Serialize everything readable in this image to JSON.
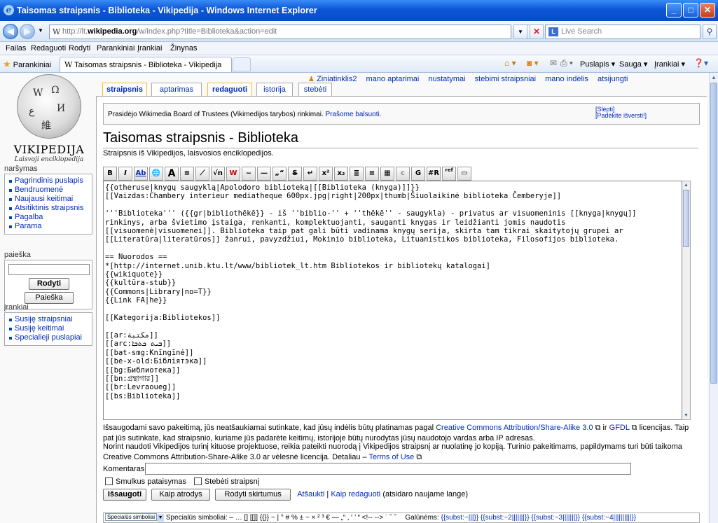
{
  "browser": {
    "window_title": "Taisomas straipsnis - Biblioteka - Vikipedija - Windows Internet Explorer",
    "address_prefix": "http://lt.",
    "address_domain": "wikipedia.org",
    "address_rest": "/w/index.php?title=Biblioteka&action=edit",
    "search_placeholder": "Live Search",
    "menu": [
      "Failas",
      "Redaguoti",
      "Rodyti",
      "Parankiniai",
      "Įrankiai",
      "Žinynas"
    ],
    "favorites_label": "Parankiniai",
    "tab_title": "Taisomas straipsnis - Biblioteka - Vikipedija",
    "page_menu": "Puslapis",
    "safety_menu": "Sauga",
    "tools_menu": "Įrankiai"
  },
  "logo": {
    "wordmark": "VIKIPEDIJA",
    "tagline": "Laisvoji enciklopedija"
  },
  "sidebar": {
    "nav_title": "naršymas",
    "nav_items": [
      "Pagrindinis puslapis",
      "Bendruomenė",
      "Naujausi keitimai",
      "Atsitiktinis straipsnis",
      "Pagalba",
      "Parama"
    ],
    "search_title": "paieška",
    "search_go": "Rodyti",
    "search_btn": "Paieška",
    "tools_title": "įrankiai",
    "tools_items": [
      "Susiję straipsniai",
      "Susiję keitimai",
      "Specialieji puslapiai"
    ]
  },
  "personal": {
    "user": "Ziniatinklis2",
    "links": [
      "mano aptarimai",
      "nustatymai",
      "stebimi straipsniai",
      "mano indėlis",
      "atsijungti"
    ]
  },
  "tabs": [
    "straipsnis",
    "aptarimas",
    "redaguoti",
    "istorija",
    "stebėti"
  ],
  "notice": {
    "text": "Prasidėjo Wikimedia Board of Trustees (Vikimedijos tarybos) rinkimai. ",
    "link": "Prašome balsuoti.",
    "hide": "[Slėpti]",
    "help": "[Padėkite išversti!]"
  },
  "heading": "Taisomas straipsnis - Biblioteka",
  "site_sub": "Straipsnis iš Vikipedijos, laisvosios enciklopedijos.",
  "toolbar_icons": [
    "B",
    "I",
    "Ab",
    "🌐",
    "A",
    "≡",
    "⟋",
    "√n",
    "W",
    "~",
    "—",
    "„“",
    "S",
    "↵",
    "x²",
    "x₂",
    "≣",
    "≡",
    "▦",
    "c",
    "G",
    "#R",
    "ref",
    "▭"
  ],
  "editor_lines": [
    "{{otheruse|knygų saugyklą|Apolodoro biblioteką|[[Biblioteka (knyga)]]}}",
    "[[Vaizdas:Chambery interieur mediatheque 600px.jpg|right|200px|thumb|Šiuolaikinė biblioteka Čemberyje]]",
    "",
    "'''Biblioteka''' ({{gr|bibliothēkē}} - iš ''biblio-'' + ''thēkē'' - saugykla) - privatus ar visuomeninis [[knyga|knygų]]",
    "rinkinys, arba švietimo įstaiga, renkanti, komplektuojanti, sauganti knygas ir leidžianti jomis naudotis",
    "[[visuomenė|visuomenei]]. Biblioteka taip pat gali būti vadinama knygų serija, skirta tam tikrai skaitytojų grupei ar",
    "[[Literatūra|literatūros]] žanrui, pavyzdžiui, Mokinio biblioteka, Lituanistikos biblioteka, Filosofijos biblioteka.",
    "",
    "== Nuorodos ==",
    "*[http://internet.unib.ktu.lt/www/bibliotek_lt.htm Bibliotekos ir bibliotekų katalogai]",
    "{{wikiquote}}",
    "{{kultūra-stub}}",
    "{{Commons|Library|no=T}}",
    "{{Link FA|he}}",
    "",
    "[[Kategorija:Bibliotekos]]",
    "",
    "[[ar:مكتبة]]",
    "[[arc:ܒܝܬ ܟܬܒܐ]]",
    "[[bat-smg:Knīngīnė]]",
    "[[be-x-old:Бібліятэка]]",
    "[[bg:Библиотека]]",
    "[[bn:গ্রন্থাগার]]",
    "[[br:Levraoueg]]",
    "[[bs:Biblioteka]]"
  ],
  "license": {
    "p1_a": "Išsaugodami savo pakeitimą, jūs neatšaukiamai sutinkate, kad jūsų indėlis būtų platinamas pagal ",
    "p1_link1": "Creative Commons Attribution/Share-Alike 3.0",
    "p1_b": " ir ",
    "p1_link2": "GFDL",
    "p1_c": " licencijas. Taip pat jūs sutinkate, kad straipsnio, kuriame jūs padarėte keitimų, istorijoje būtų nurodytas jūsų naudotojo vardas arba IP adresas.",
    "p2_a": "Norint naudoti Vikipedijos turinį kituose projektuose, reikia pateikti nuorodą į Vikipedijos straipsnį ar nuolatinę jo kopiją. Turinio pakeitimams, papildymams turi būti taikoma Creative Commons Attribution-Share-Alike 3.0 ar vėlesnė licencija. Detaliau – ",
    "p2_link": "Terms of Use"
  },
  "form": {
    "summary_label": "Komentaras",
    "minor_label": "Smulkus pataisymas",
    "watch_label": "Stebėti straipsnį",
    "save": "Išsaugoti",
    "preview": "Kaip atrodys",
    "diff": "Rodyti skirtumus",
    "cancel": "Atšaukti",
    "sep": " | ",
    "help": "Kaip redaguoti",
    "help_note": " (atsidaro naujame lange)"
  },
  "charbar": {
    "select": "Specialūs simboliai",
    "label": "Specialūs simboliai: – … [] [[]] {{}} ~ | ° # % ± − × ² ³ € — „“ ‚ ‘ ’ “ <!-- --> ˙ ˇ ˝",
    "endings_label": "Galūnėms:",
    "endings": "{{subst:~|||}} {{subst:~2|||||||}} {{subst:~3|||||||}} {{subst:~4||||||||||}}"
  }
}
